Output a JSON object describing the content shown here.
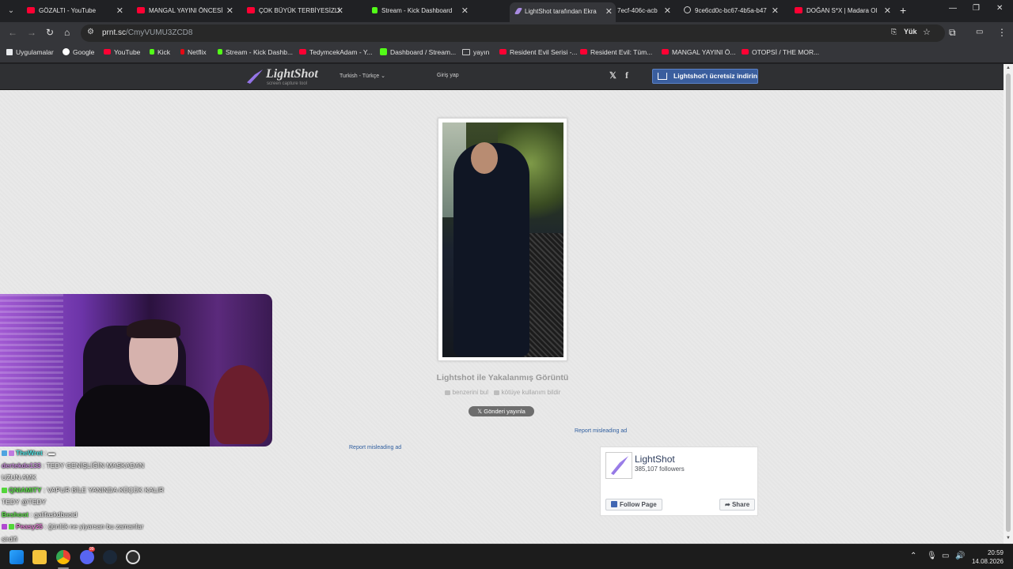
{
  "browser": {
    "tabs": [
      {
        "label": "GÖZALTI - YouTube",
        "icon": "youtube-icon",
        "active": false
      },
      {
        "label": "MANGAL YAYINI ÖNCESİ",
        "icon": "youtube-icon",
        "active": false
      },
      {
        "label": "ÇOK BÜYÜK TERBİYESİZLİ",
        "icon": "youtube-icon",
        "active": false
      },
      {
        "label": "Stream - Kick Dashboard",
        "icon": "kick-icon",
        "active": false
      },
      {
        "label": "LightShot tarafından Ekra",
        "icon": "lightshot-icon",
        "active": true
      },
      {
        "label": "7ecf-406c-acb",
        "icon": "none",
        "active": false
      },
      {
        "label": "9ce6cd0c-bc67-4b5a-b47",
        "icon": "globe-icon",
        "active": false
      },
      {
        "label": "DOĞAN S*X | Madara Ol",
        "icon": "youtube-icon",
        "active": false
      }
    ],
    "url_host": "prnt.sc",
    "url_path": "/CmyVUMU3ZCD8",
    "omnibox_badge": "Yük",
    "bookmarks": [
      {
        "label": "Uygulamalar",
        "icon": "apps-grid-icon"
      },
      {
        "label": "Google",
        "icon": "google-icon"
      },
      {
        "label": "YouTube",
        "icon": "youtube-icon"
      },
      {
        "label": "Kick",
        "icon": "kick-icon"
      },
      {
        "label": "Netflix",
        "icon": "netflix-icon"
      },
      {
        "label": "Stream - Kick Dashb...",
        "icon": "kick-icon"
      },
      {
        "label": "TedymcekAdam - Y...",
        "icon": "youtube-icon"
      },
      {
        "label": "Dashboard / Stream...",
        "icon": "dashboard-icon"
      },
      {
        "label": "yayın",
        "icon": "folder-icon"
      },
      {
        "label": "Resident Evil Serisi -...",
        "icon": "youtube-icon"
      },
      {
        "label": "Resident Evil: Tüm...",
        "icon": "youtube-icon"
      },
      {
        "label": "MANGAL YAYINI Ö...",
        "icon": "youtube-icon"
      },
      {
        "label": "OTOPSİ / THE MOR...",
        "icon": "youtube-icon"
      }
    ]
  },
  "lightshot": {
    "logo_name": "LightShot",
    "logo_tagline": "screen capture tool",
    "language": "Turkish - Türkçe",
    "login": "Giriş yap",
    "download_button": "Lightshot'ı ücretsiz indirin",
    "shot_title": "Lightshot ile Yakalanmış Görüntü",
    "similar_link": "benzerini bul",
    "report_abuse_link": "kötüye kullanım bildir",
    "tweet_button": "Gönderi yayınla",
    "report_ad_1": "Report misleading ad",
    "report_ad_2": "Report misleading ad",
    "fb_page_name": "LightShot",
    "fb_followers": "385,107 followers",
    "fb_follow": "Follow Page",
    "fb_share": "Share"
  },
  "stream_chat": [
    {
      "user": "TheWret",
      "msg": ": ▬",
      "color": "#4fe0e0"
    },
    {
      "user": "dertekde133",
      "msg": ": TEDY GENİŞLİĞİN MASKADAN",
      "color": "#c58ad8"
    },
    {
      "user": "",
      "msg": "UZUN AMK",
      "color": "#f0f0f0"
    },
    {
      "user": "QNIAMITY",
      "msg": ": VAPUR BİLE YANINDA KÜÇÜK KALIR",
      "color": "#5ee04a"
    },
    {
      "user": "",
      "msg": "TEDY @TEDY",
      "color": "#f0f0f0"
    },
    {
      "user": "Beshoot",
      "msg": ": galifaskdbaoid",
      "color": "#5ee04a"
    },
    {
      "user": "Peasy25",
      "msg": ": ğünlük ne yiyarsan bu zamanlar",
      "color": "#e07ad0"
    },
    {
      "user": "",
      "msg": "sirdifi",
      "color": "#f0f0f0"
    }
  ],
  "taskbar": {
    "time": "20:59",
    "date": "14.08.2026",
    "discord_badge": "99"
  }
}
